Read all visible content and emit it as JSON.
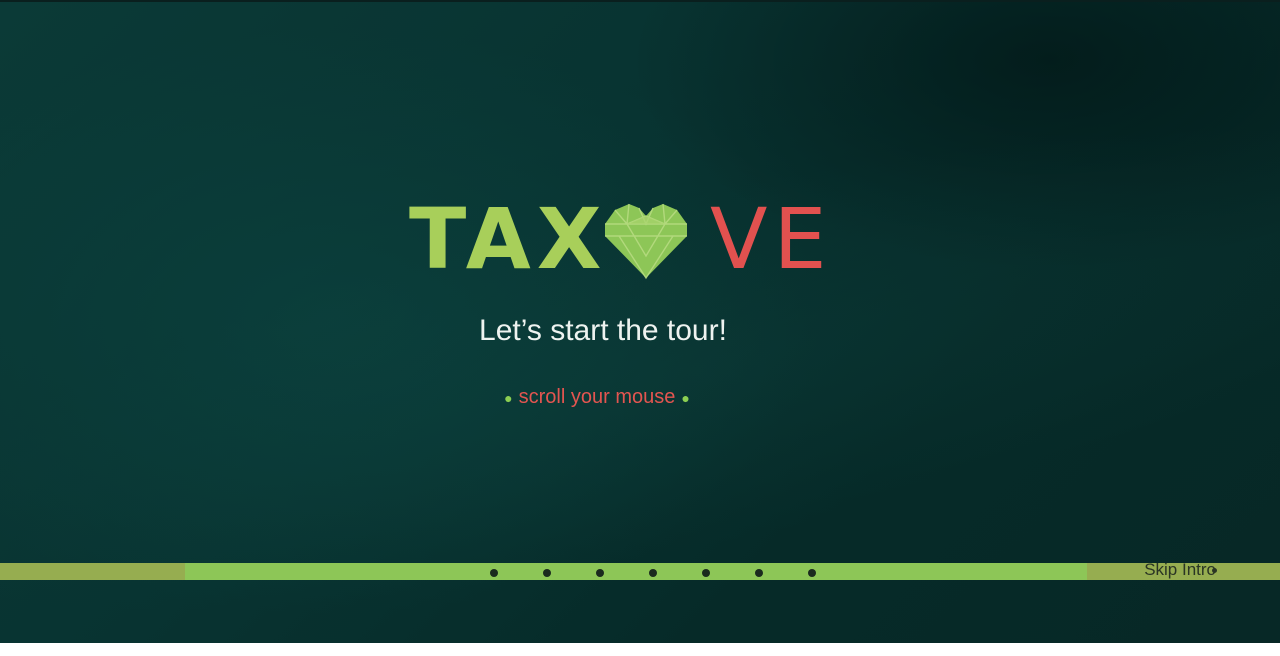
{
  "logo": {
    "left_text": "TAX",
    "right_text": "VE",
    "heart_icon": "heart-icon",
    "colors": {
      "left": "#a8cf5a",
      "right": "#e2514f",
      "heart": "#8dc657"
    }
  },
  "intro": {
    "tagline": "Let’s start the tour!",
    "scroll_hint": "scroll your mouse"
  },
  "progress": {
    "step_count": 7,
    "skip_label": "Skip Intro"
  },
  "colors": {
    "background": "#083331",
    "bar": "#96ad50",
    "bar_active": "#8dc657",
    "tagline": "#eef3f0",
    "hint": "#e35550"
  }
}
